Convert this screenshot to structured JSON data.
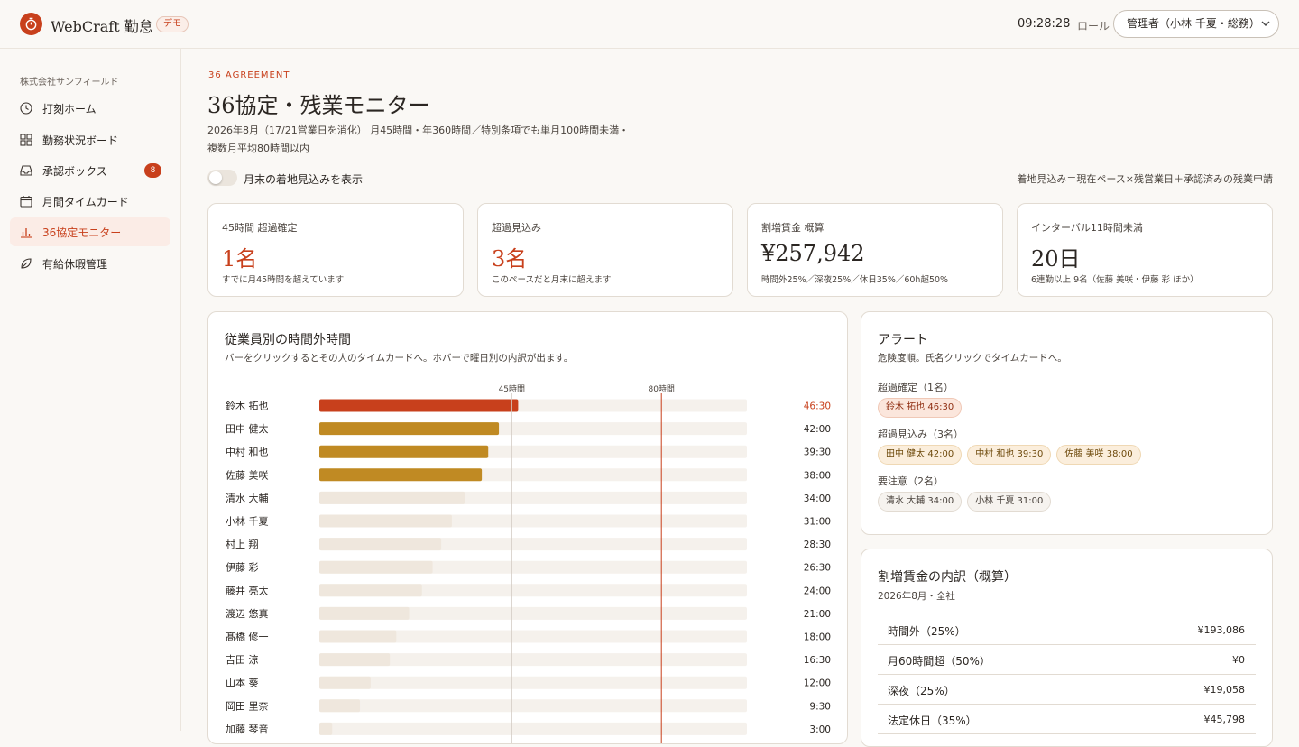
{
  "app": {
    "name": "WebCraft 勤怠",
    "badge": "デモ"
  },
  "header": {
    "clock": "09:28:28",
    "role_label": "ロール",
    "role_value": "管理者（小林 千夏・総務）"
  },
  "sidebar": {
    "company": "株式会社サンフィールド",
    "items": [
      {
        "label": "打刻ホーム",
        "icon": "clock-icon"
      },
      {
        "label": "勤務状況ボード",
        "icon": "grid-icon"
      },
      {
        "label": "承認ボックス",
        "icon": "inbox-icon",
        "count": "8"
      },
      {
        "label": "月間タイムカード",
        "icon": "calendar-icon"
      },
      {
        "label": "36協定モニター",
        "icon": "bar-chart-icon",
        "active": true
      },
      {
        "label": "有給休暇管理",
        "icon": "leaf-icon"
      }
    ]
  },
  "page": {
    "kicker": "36 AGREEMENT",
    "title": "36協定・残業モニター",
    "desc_line1": "2026年8月（17/21営業日を消化） 月45時間・年360時間／特別条項でも単月100時間未満・",
    "desc_line2": "複数月平均80時間以内",
    "toggle_label": "月末の着地見込みを表示",
    "legend_note": "着地見込み＝現在ペース×残営業日＋承認済みの残業申請"
  },
  "kpis": [
    {
      "label": "45時間 超過確定",
      "value": "1名",
      "sub": "すでに月45時間を超えています",
      "hot": true
    },
    {
      "label": "超過見込み",
      "value": "3名",
      "sub": "このペースだと月末に超えます",
      "hot": true
    },
    {
      "label": "割増賃金 概算",
      "value": "¥257,942",
      "sub": "時間外25%／深夜25%／休日35%／60h超50%",
      "hot": false
    },
    {
      "label": "インターバル11時間未満",
      "value": "20日",
      "sub": "6連勤以上 9名（佐藤 美咲・伊藤 彩 ほか）",
      "hot": false
    }
  ],
  "chart_panel": {
    "title": "従業員別の時間外時間",
    "sub": "バーをクリックするとその人のタイムカードへ。ホバーで曜日別の内訳が出ます。"
  },
  "chart_data": {
    "type": "bar",
    "orientation": "horizontal",
    "unit": "hours",
    "xlim": [
      0,
      100
    ],
    "reference_lines": [
      {
        "label": "45時間",
        "value": 45
      },
      {
        "label": "80時間",
        "value": 80
      }
    ],
    "colors": {
      "over": "#c8401c",
      "projected": "#c08a23",
      "normal": "#efe7dd",
      "track": "#f5f1ec",
      "ref45": "#d3ccc4",
      "ref80": "#c8401c"
    },
    "rows": [
      {
        "name": "鈴木 拓也",
        "label": "46:30",
        "value": 46.5,
        "status": "over"
      },
      {
        "name": "田中 健太",
        "label": "42:00",
        "value": 42.0,
        "status": "projected"
      },
      {
        "name": "中村 和也",
        "label": "39:30",
        "value": 39.5,
        "status": "projected"
      },
      {
        "name": "佐藤 美咲",
        "label": "38:00",
        "value": 38.0,
        "status": "projected"
      },
      {
        "name": "清水 大輔",
        "label": "34:00",
        "value": 34.0,
        "status": "normal"
      },
      {
        "name": "小林 千夏",
        "label": "31:00",
        "value": 31.0,
        "status": "normal"
      },
      {
        "name": "村上 翔",
        "label": "28:30",
        "value": 28.5,
        "status": "normal"
      },
      {
        "name": "伊藤 彩",
        "label": "26:30",
        "value": 26.5,
        "status": "normal"
      },
      {
        "name": "藤井 亮太",
        "label": "24:00",
        "value": 24.0,
        "status": "normal"
      },
      {
        "name": "渡辺 悠真",
        "label": "21:00",
        "value": 21.0,
        "status": "normal"
      },
      {
        "name": "髙橋 修一",
        "label": "18:00",
        "value": 18.0,
        "status": "normal"
      },
      {
        "name": "吉田 涼",
        "label": "16:30",
        "value": 16.5,
        "status": "normal"
      },
      {
        "name": "山本 葵",
        "label": "12:00",
        "value": 12.0,
        "status": "normal"
      },
      {
        "name": "岡田 里奈",
        "label": "9:30",
        "value": 9.5,
        "status": "normal"
      },
      {
        "name": "加藤 琴音",
        "label": "3:00",
        "value": 3.0,
        "status": "normal"
      }
    ]
  },
  "alerts": {
    "title": "アラート",
    "sub": "危険度順。氏名クリックでタイムカードへ。",
    "groups": [
      {
        "label": "超過確定（1名）",
        "tone": "red",
        "items": [
          "鈴木 拓也 46:30"
        ]
      },
      {
        "label": "超過見込み（3名）",
        "tone": "amber",
        "items": [
          "田中 健太 42:00",
          "中村 和也 39:30",
          "佐藤 美咲 38:00"
        ]
      },
      {
        "label": "要注意（2名）",
        "tone": "gray",
        "items": [
          "清水 大輔 34:00",
          "小林 千夏 31:00"
        ]
      }
    ]
  },
  "wages": {
    "title": "割増賃金の内訳（概算）",
    "sub": "2026年8月・全社",
    "rows": [
      {
        "k": "時間外（25%）",
        "v": "¥193,086"
      },
      {
        "k": "月60時間超（50%）",
        "v": "¥0"
      },
      {
        "k": "深夜（25%）",
        "v": "¥19,058"
      },
      {
        "k": "法定休日（35%）",
        "v": "¥45,798"
      }
    ]
  }
}
